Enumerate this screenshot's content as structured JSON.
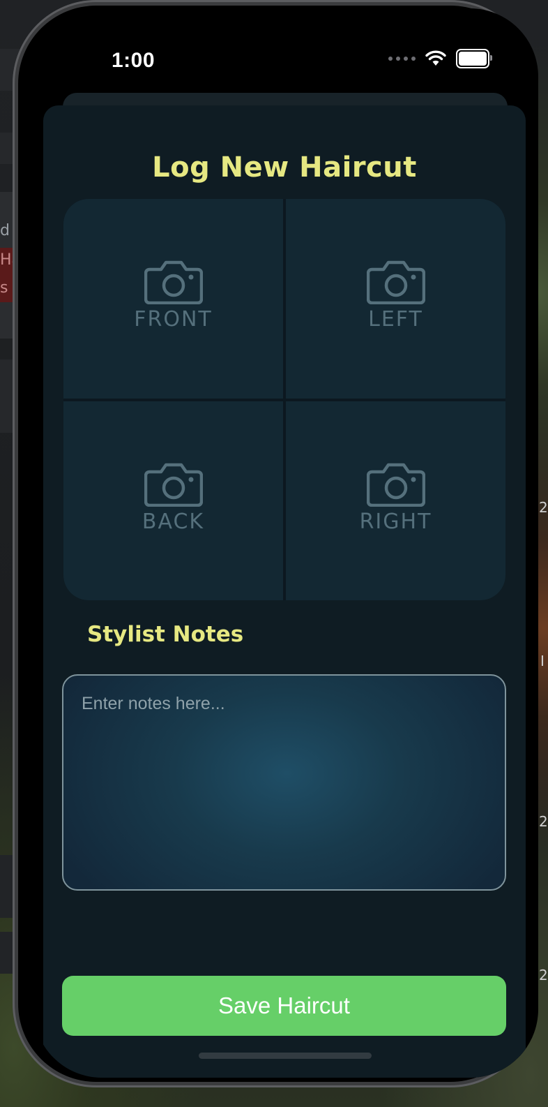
{
  "status_bar": {
    "time": "1:00",
    "icons": [
      "cellular-signal-icon",
      "wifi-icon",
      "battery-icon"
    ]
  },
  "background_window": {
    "fragments": [
      "d",
      "Ha",
      "s"
    ],
    "right_edge_marks": [
      "2",
      "I",
      "2",
      "2"
    ]
  },
  "sheet": {
    "title": "Log New Haircut",
    "photos": [
      {
        "label": "FRONT",
        "icon": "camera-icon"
      },
      {
        "label": "LEFT",
        "icon": "camera-icon"
      },
      {
        "label": "BACK",
        "icon": "camera-icon"
      },
      {
        "label": "RIGHT",
        "icon": "camera-icon"
      }
    ],
    "notes_label": "Stylist Notes",
    "notes_value": "",
    "notes_placeholder": "Enter notes here...",
    "save_label": "Save Haircut"
  },
  "colors": {
    "accent_title": "#e6e882",
    "save_button": "#66cf68",
    "sheet_background": "#0f1c23",
    "photo_cell": "#132833"
  }
}
